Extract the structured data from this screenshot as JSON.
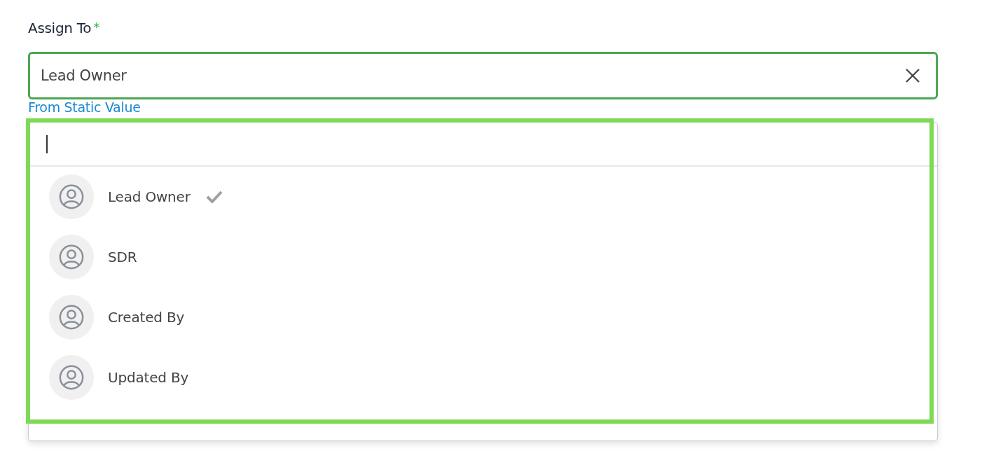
{
  "field": {
    "label": "Assign To",
    "required_mark": "*",
    "value": "Lead Owner",
    "hint_link": "From Static Value"
  },
  "dropdown": {
    "options": [
      {
        "label": "Lead Owner",
        "selected": true
      },
      {
        "label": "SDR",
        "selected": false
      },
      {
        "label": "Created By",
        "selected": false
      },
      {
        "label": "Updated By",
        "selected": false
      }
    ]
  }
}
